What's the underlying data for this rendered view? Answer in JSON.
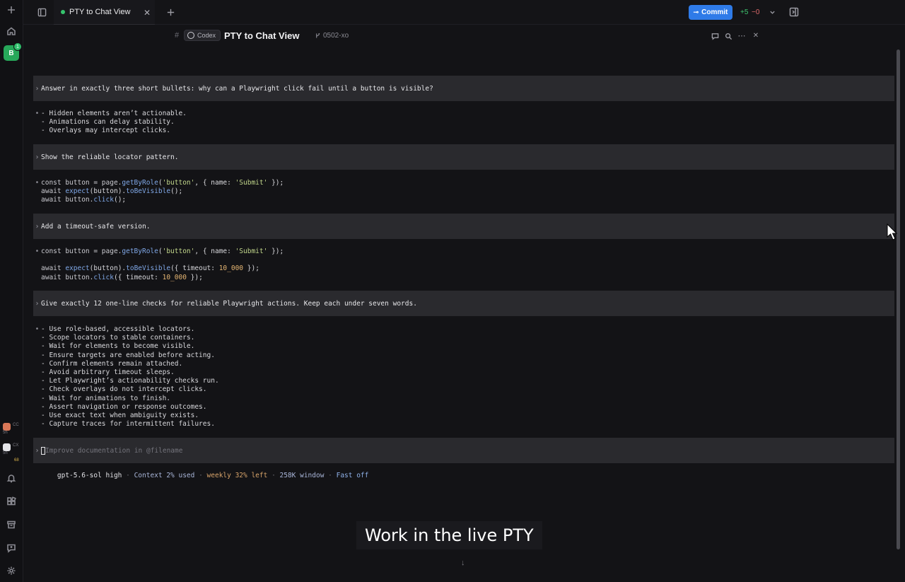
{
  "tab": {
    "title": "PTY to Chat View",
    "close": "✕",
    "new": "+"
  },
  "toolbar": {
    "commit_label": "Commit",
    "additions": "+5",
    "deletions": "−0"
  },
  "header": {
    "hash": "#",
    "agent": "Codex",
    "title": "PTY to Chat View",
    "branch": "0502-xo"
  },
  "rail": {
    "workspace_initial": "B",
    "workspace_badge": "1",
    "mini_sessions": [
      {
        "line1": "CC",
        "line2": "5h"
      },
      {
        "line1": "CX",
        "line2": "5h"
      }
    ],
    "mini_count": "68"
  },
  "conversation": [
    {
      "type": "prompt",
      "text": "Answer in exactly three short bullets: why can a Playwright click fail until a button is visible?"
    },
    {
      "type": "response",
      "lines": [
        "- Hidden elements aren’t actionable.",
        "- Animations can delay stability.",
        "- Overlays may intercept clicks."
      ]
    },
    {
      "type": "prompt",
      "text": "Show the reliable locator pattern."
    },
    {
      "type": "prompt",
      "text": "Add a timeout-safe version."
    },
    {
      "type": "prompt",
      "text": "Give exactly 12 one-line checks for reliable Playwright actions. Keep each under seven words."
    },
    {
      "type": "response",
      "lines": [
        "- Use role-based, accessible locators.",
        "- Scope locators to stable containers.",
        "- Wait for elements to become visible.",
        "- Ensure targets are enabled before acting.",
        "- Confirm elements remain attached.",
        "- Avoid arbitrary timeout sleeps.",
        "- Let Playwright’s actionability checks run.",
        "- Check overlays do not intercept clicks.",
        "- Wait for animations to finish.",
        "- Assert navigation or response outcomes.",
        "- Use exact text when ambiguity exists.",
        "- Capture traces for intermittent failures."
      ]
    }
  ],
  "code1": {
    "l1": {
      "a": "const button = page.",
      "fn": "getByRole",
      "b": "(",
      "s1": "'button'",
      "c": ", { name: ",
      "s2": "'Submit'",
      "d": " });"
    },
    "l2": {
      "a": "await ",
      "fn1": "expect",
      "b": "(button).",
      "fn2": "toBeVisible",
      "c": "();"
    },
    "l3": {
      "a": "await button.",
      "fn": "click",
      "b": "();"
    }
  },
  "code2": {
    "l1": {
      "a": "const button = page.",
      "fn": "getByRole",
      "b": "(",
      "s1": "'button'",
      "c": ", { name: ",
      "s2": "'Submit'",
      "d": " });"
    },
    "l2": {
      "a": "await ",
      "fn1": "expect",
      "b": "(button).",
      "fn2": "toBeVisible",
      "c": "({ timeout: ",
      "n": "10_000",
      "d": " });"
    },
    "l3": {
      "a": "await button.",
      "fn": "click",
      "b": "({ timeout: ",
      "n": "10_000",
      "c": " });"
    }
  },
  "input": {
    "prompt_chevron": "›",
    "bullet": "•",
    "placeholder": "Improve documentation in @filename"
  },
  "status": {
    "model": "gpt-5.6-sol high",
    "sep": " · ",
    "context": "Context 2% used",
    "weekly": "weekly 32% left",
    "window": "258K window",
    "fast": "Fast off"
  },
  "caption": "Work in the live PTY",
  "scroll_down": "↓"
}
